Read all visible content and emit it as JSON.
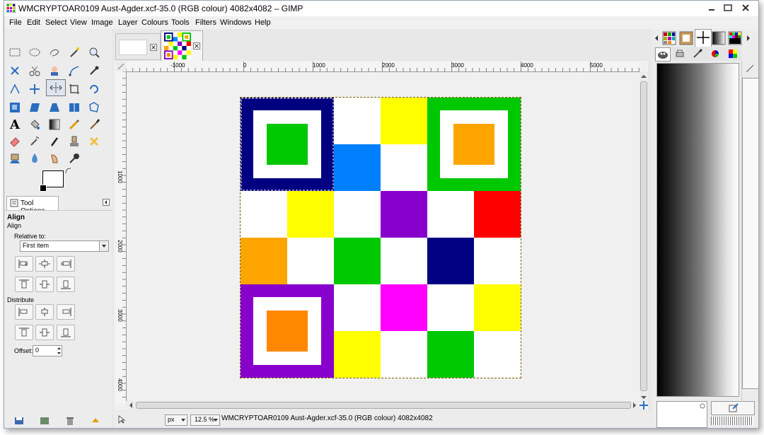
{
  "window": {
    "title": "WMCRYPTOAR0109 Aust-Agder.xcf-35.0 (RGB colour) 4082x4082 – GIMP"
  },
  "menu": {
    "items": [
      "File",
      "Edit",
      "Select",
      "View",
      "Image",
      "Layer",
      "Colours",
      "Tools",
      "Filters",
      "Windows",
      "Help"
    ]
  },
  "tool_options": {
    "tab_label": "Tool Options",
    "tool_name": "Align",
    "tool_subtitle": "Align",
    "relative_label": "Relative to:",
    "relative_value": "First item",
    "distribute_label": "Distribute",
    "offset_label": "Offset:",
    "offset_value": "0"
  },
  "ruler": {
    "h_labels": [
      "-1000",
      "0",
      "1000",
      "2000",
      "3000",
      "4000",
      "5000"
    ],
    "v_labels": [
      "1000",
      "2000",
      "3000",
      "4000"
    ]
  },
  "status": {
    "unit": "px",
    "zoom": "12.5 %",
    "message": "WMCRYPTOAR0109 Aust-Agder.xcf-35.0 (RGB colour) 4082x4082"
  },
  "canvas": {
    "grid_colors": [
      [
        "#000080",
        "#000080",
        "#ffffff",
        "#ffff00",
        "#00c800",
        "#00c800"
      ],
      [
        "#000080",
        "#000080",
        "#0080ff",
        "#ffffff",
        "#00c800",
        "#00c800"
      ],
      [
        "#ffffff",
        "#ffff00",
        "#ffffff",
        "#8800cc",
        "#ffffff",
        "#ff0000"
      ],
      [
        "#ffa500",
        "#ffffff",
        "#00c800",
        "#ffffff",
        "#000080",
        "#ffffff"
      ],
      [
        "#8800cc",
        "#8800cc",
        "#ffffff",
        "#ff00ff",
        "#ffffff",
        "#ffff00"
      ],
      [
        "#8800cc",
        "#8800cc",
        "#ffff00",
        "#ffffff",
        "#00c800",
        "#ffffff"
      ]
    ],
    "markers": [
      {
        "frame": "#000080",
        "center": "#00c800"
      },
      {
        "frame": "#00c800",
        "center": "#ffa500"
      },
      {
        "frame": "#8800cc",
        "center": "#ff8800"
      }
    ]
  }
}
